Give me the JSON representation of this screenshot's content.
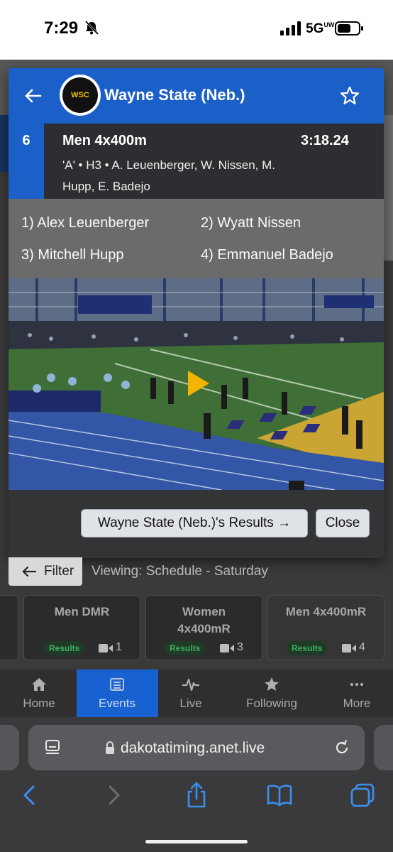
{
  "status_bar": {
    "time": "7:29",
    "network": "5G",
    "network_sub": "UW"
  },
  "modal": {
    "team_name": "Wayne State (Neb.)",
    "logo_text": "WSC",
    "result": {
      "place": "6",
      "event": "Men 4x400m",
      "time": "3:18.24",
      "detail": "'A' • H3 • A. Leuenberger, W. Nissen, M. Hupp, E. Badejo"
    },
    "athletes": [
      "1) Alex Leuenberger",
      "2) Wyatt Nissen",
      "3) Mitchell Hupp",
      "4) Emmanuel Badejo"
    ],
    "results_button": "Wayne State (Neb.)'s Results →",
    "close_button": "Close"
  },
  "filter": {
    "label": "Filter",
    "viewing": "Viewing: Schedule - Saturday"
  },
  "event_cards": [
    {
      "title_line1": "Men DMR",
      "title_line2": "",
      "badge": "Results",
      "video_count": "1"
    },
    {
      "title_line1": "Women",
      "title_line2": "4x400mR",
      "badge": "Results",
      "video_count": "3"
    },
    {
      "title_line1": "Men 4x400mR",
      "title_line2": "",
      "badge": "Results",
      "video_count": "4"
    }
  ],
  "nav": {
    "items": [
      {
        "label": "Home",
        "icon": "home-icon"
      },
      {
        "label": "Events",
        "icon": "list-icon",
        "active": true
      },
      {
        "label": "Live",
        "icon": "pulse-icon"
      },
      {
        "label": "Following",
        "icon": "star-icon"
      },
      {
        "label": "More",
        "icon": "ellipsis-icon"
      }
    ]
  },
  "browser": {
    "url": "dakotatiming.anet.live"
  },
  "colors": {
    "accent": "#1b5fc9",
    "nav_active": "#1761d0",
    "badge_text": "#3fae5f"
  }
}
